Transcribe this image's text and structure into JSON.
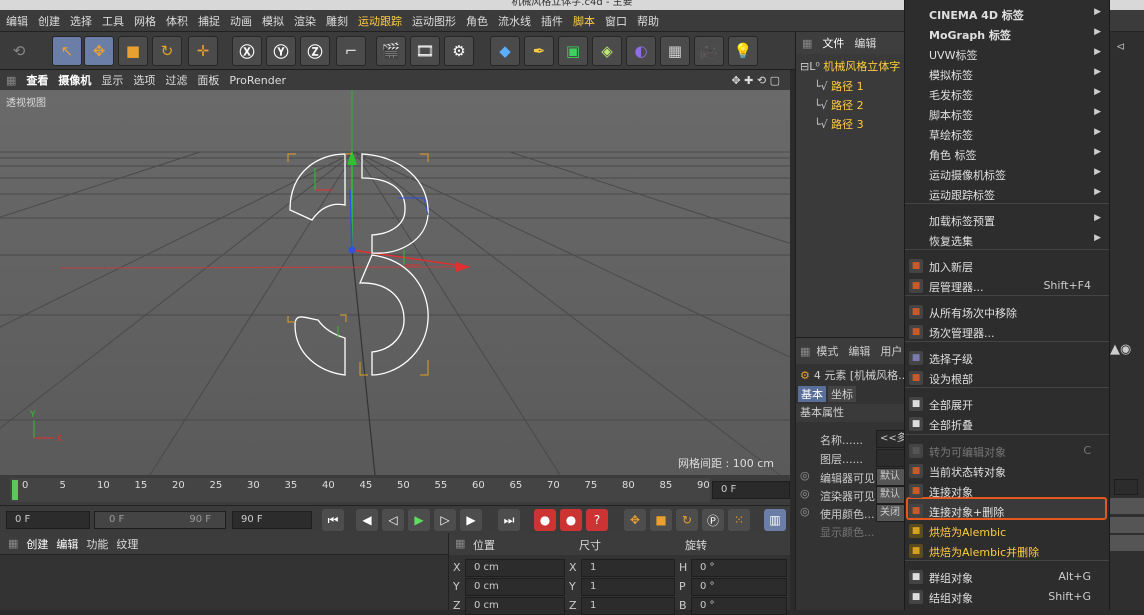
{
  "window_title": "机械风格立体字.c4d - 主要",
  "menubar": {
    "items": [
      "编辑",
      "创建",
      "选择",
      "工具",
      "网格",
      "体积",
      "捕捉",
      "动画",
      "模拟",
      "渲染",
      "雕刻",
      "运动跟踪",
      "运动图形",
      "角色",
      "流水线",
      "插件",
      "脚本",
      "窗口",
      "帮助"
    ],
    "highlighted": [
      "运动跟踪",
      "脚本"
    ]
  },
  "viewport": {
    "menu": [
      "查看",
      "摄像机",
      "显示",
      "选项",
      "过滤",
      "面板",
      "ProRender"
    ],
    "label": "透视视图",
    "grid_label": "网格间距 : 100 cm"
  },
  "timeline": {
    "ticks": [
      "0",
      "5",
      "10",
      "15",
      "20",
      "25",
      "30",
      "35",
      "40",
      "45",
      "50",
      "55",
      "60",
      "65",
      "70",
      "75",
      "80",
      "85",
      "90"
    ],
    "current": "0 F"
  },
  "transport": {
    "start": "0 F",
    "range_start": "0 F",
    "range_end": "90 F",
    "end": "90 F"
  },
  "material": {
    "menu": [
      "创建",
      "编辑",
      "功能",
      "纹理"
    ]
  },
  "coords": {
    "headers": [
      "位置",
      "尺寸",
      "旋转"
    ],
    "rows": [
      {
        "axis": "X",
        "pos": "0 cm",
        "size_axis": "X",
        "size": "1",
        "rot_axis": "H",
        "rot": "0 °"
      },
      {
        "axis": "Y",
        "pos": "0 cm",
        "size_axis": "Y",
        "size": "1",
        "rot_axis": "P",
        "rot": "0 °"
      },
      {
        "axis": "Z",
        "pos": "0 cm",
        "size_axis": "Z",
        "size": "1",
        "rot_axis": "B",
        "rot": "0 °"
      }
    ]
  },
  "objects": {
    "menu": [
      "文件",
      "编辑"
    ],
    "root": "机械风格立体字",
    "children": [
      "路径 1",
      "路径 2",
      "路径 3"
    ]
  },
  "attributes": {
    "menu": [
      "模式",
      "编辑",
      "用户"
    ],
    "info": "4 元素 [机械风格...",
    "tabs": [
      "基本",
      "坐标"
    ],
    "section": "基本属性",
    "fields": [
      "名称......",
      "图层......",
      "编辑器可见",
      "渲染器可见",
      "使用颜色...",
      "显示颜色..."
    ],
    "name_value": "<<多",
    "editor_visible": "默认",
    "render_visible": "默认",
    "use_color": "关闭"
  },
  "context_menu": {
    "items": [
      {
        "label": "CINEMA 4D 标签",
        "submenu": true,
        "bold": true
      },
      {
        "label": "MoGraph 标签",
        "submenu": true,
        "bold": true
      },
      {
        "label": "UVW标签",
        "submenu": true
      },
      {
        "label": "模拟标签",
        "submenu": true
      },
      {
        "label": "毛发标签",
        "submenu": true
      },
      {
        "label": "脚本标签",
        "submenu": true
      },
      {
        "label": "草绘标签",
        "submenu": true
      },
      {
        "label": "角色 标签",
        "submenu": true
      },
      {
        "label": "运动摄像机标签",
        "submenu": true
      },
      {
        "label": "运动跟踪标签",
        "submenu": true
      },
      {
        "label": "加载标签预置",
        "submenu": true
      },
      {
        "label": "恢复选集",
        "submenu": true
      },
      {
        "label": "加入新层",
        "icon": "layer-add-icon"
      },
      {
        "label": "层管理器...",
        "shortcut": "Shift+F4",
        "icon": "layer-manager-icon"
      },
      {
        "label": "从所有场次中移除",
        "icon": "take-remove-icon"
      },
      {
        "label": "场次管理器...",
        "icon": "take-manager-icon"
      },
      {
        "label": "选择子级",
        "icon": "select-children-icon"
      },
      {
        "label": "设为根部",
        "icon": "set-root-icon"
      },
      {
        "label": "全部展开",
        "icon": "expand-all-icon"
      },
      {
        "label": "全部折叠",
        "icon": "collapse-all-icon"
      },
      {
        "label": "转为可编辑对象",
        "shortcut": "C",
        "disabled": true,
        "icon": "make-editable-icon"
      },
      {
        "label": "当前状态转对象",
        "icon": "current-state-icon"
      },
      {
        "label": "连接对象",
        "icon": "connect-icon"
      },
      {
        "label": "连接对象+删除",
        "icon": "connect-delete-icon",
        "highlighted": true
      },
      {
        "label": "烘焙为Alembic",
        "icon": "alembic-icon",
        "yellow": true
      },
      {
        "label": "烘焙为Alembic并删除",
        "icon": "alembic-delete-icon",
        "yellow": true
      },
      {
        "label": "群组对象",
        "shortcut": "Alt+G",
        "icon": "group-icon"
      },
      {
        "label": "结组对象",
        "shortcut": "Shift+G",
        "icon": "ungroup-icon"
      }
    ]
  },
  "colors": {
    "accent": "#ffcc40",
    "highlight_border": "#e2581f",
    "axis_x": "#e03030",
    "axis_y": "#30c030",
    "axis_z": "#3050e0"
  }
}
